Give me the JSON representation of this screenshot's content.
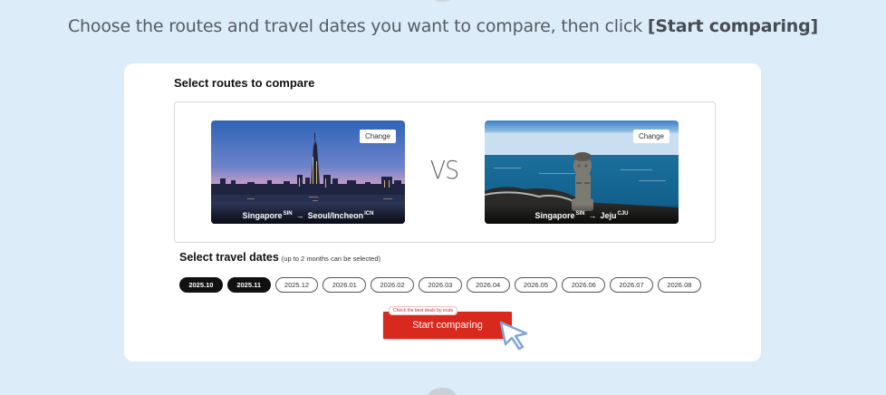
{
  "header": {
    "instruction_text": "Choose the routes and travel dates you want to compare, then click ",
    "instruction_bold": "[Start comparing]"
  },
  "routes": {
    "title": "Select routes to compare",
    "vs_label": "VS",
    "left": {
      "change_label": "Change",
      "origin": "Singapore",
      "origin_code": "SIN",
      "arrow": "→",
      "destination": "Seoul/Incheon",
      "destination_code": "ICN"
    },
    "right": {
      "change_label": "Change",
      "origin": "Singapore",
      "origin_code": "SIN",
      "arrow": "→",
      "destination": "Jeju",
      "destination_code": "CJU"
    }
  },
  "dates": {
    "title": "Select travel dates",
    "note": "(up to 2 months can be selected)",
    "months": [
      {
        "label": "2025.10",
        "selected": true
      },
      {
        "label": "2025.11",
        "selected": true
      },
      {
        "label": "2025.12",
        "selected": false
      },
      {
        "label": "2026.01",
        "selected": false
      },
      {
        "label": "2026.02",
        "selected": false
      },
      {
        "label": "2026.03",
        "selected": false
      },
      {
        "label": "2026.04",
        "selected": false
      },
      {
        "label": "2026.05",
        "selected": false
      },
      {
        "label": "2026.06",
        "selected": false
      },
      {
        "label": "2026.07",
        "selected": false
      },
      {
        "label": "2026.08",
        "selected": false
      }
    ]
  },
  "action": {
    "hint": "Check the best deals by route",
    "start_label": "Start comparing"
  },
  "colors": {
    "page_bg": "#dcecf9",
    "accent_red": "#d9291f",
    "selected_pill": "#111111"
  },
  "icons": {
    "cursor": "pointer-cursor-icon"
  }
}
